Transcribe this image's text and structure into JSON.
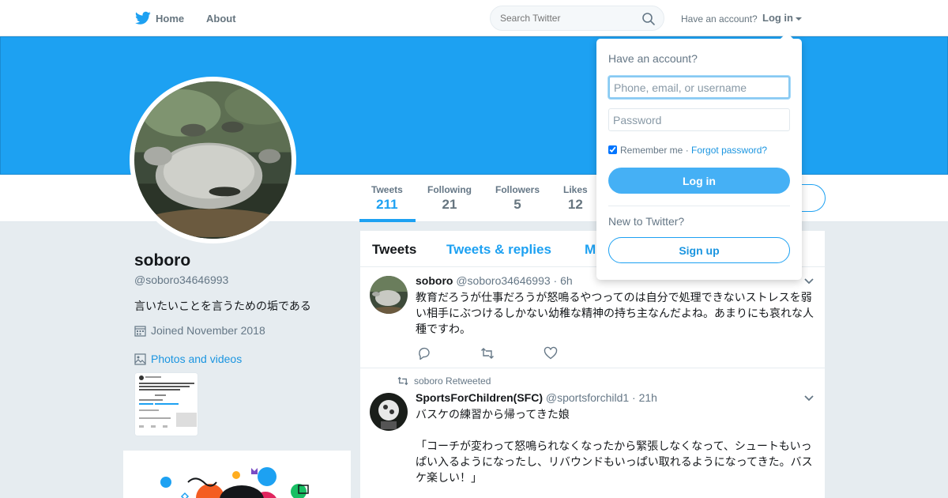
{
  "nav": {
    "home_label": "Home",
    "about_label": "About",
    "search_placeholder": "Search Twitter",
    "have_account": "Have an account?",
    "login_label": "Log in"
  },
  "profile": {
    "name": "soboro",
    "handle": "@soboro34646993",
    "bio": "言いたいことを言うための垢である",
    "joined": "Joined November 2018",
    "photos_label": "Photos and videos"
  },
  "stats": [
    {
      "label": "Tweets",
      "value": "211"
    },
    {
      "label": "Following",
      "value": "21"
    },
    {
      "label": "Followers",
      "value": "5"
    },
    {
      "label": "Likes",
      "value": "12"
    }
  ],
  "timeline": {
    "tabs": [
      "Tweets",
      "Tweets & replies",
      "M"
    ],
    "tweets": [
      {
        "name": "soboro",
        "handle": "@soboro34646993",
        "time": "6h",
        "text": "教育だろうが仕事だろうが怒鳴るやつってのは自分で処理できないストレスを弱い相手にぶつけるしかない幼稚な精神の持ち主なんだよね。あまりにも哀れな人種ですわ。"
      },
      {
        "retweeted_by": "soboro Retweeted",
        "name": "SportsForChildren(SFC)",
        "handle": "@sportsforchild1",
        "time": "21h",
        "text_line1": "バスケの練習から帰ってきた娘",
        "text_line2": "「コーチが変わって怒鳴られなくなったから緊張しなくなって、シュートもいっぱい入るようになったし、リバウンドもいっぱい取れるようになってきた。バスケ楽しい！」"
      }
    ]
  },
  "dropdown": {
    "title": "Have an account?",
    "username_placeholder": "Phone, email, or username",
    "password_placeholder": "Password",
    "remember_label": "Remember me",
    "separator": "·",
    "forgot_label": "Forgot password?",
    "login_button": "Log in",
    "new_label": "New to Twitter?",
    "signup_button": "Sign up"
  },
  "colors": {
    "accent": "#1da1f2",
    "banner": "#1da1f2",
    "background": "#e6ecf0"
  }
}
